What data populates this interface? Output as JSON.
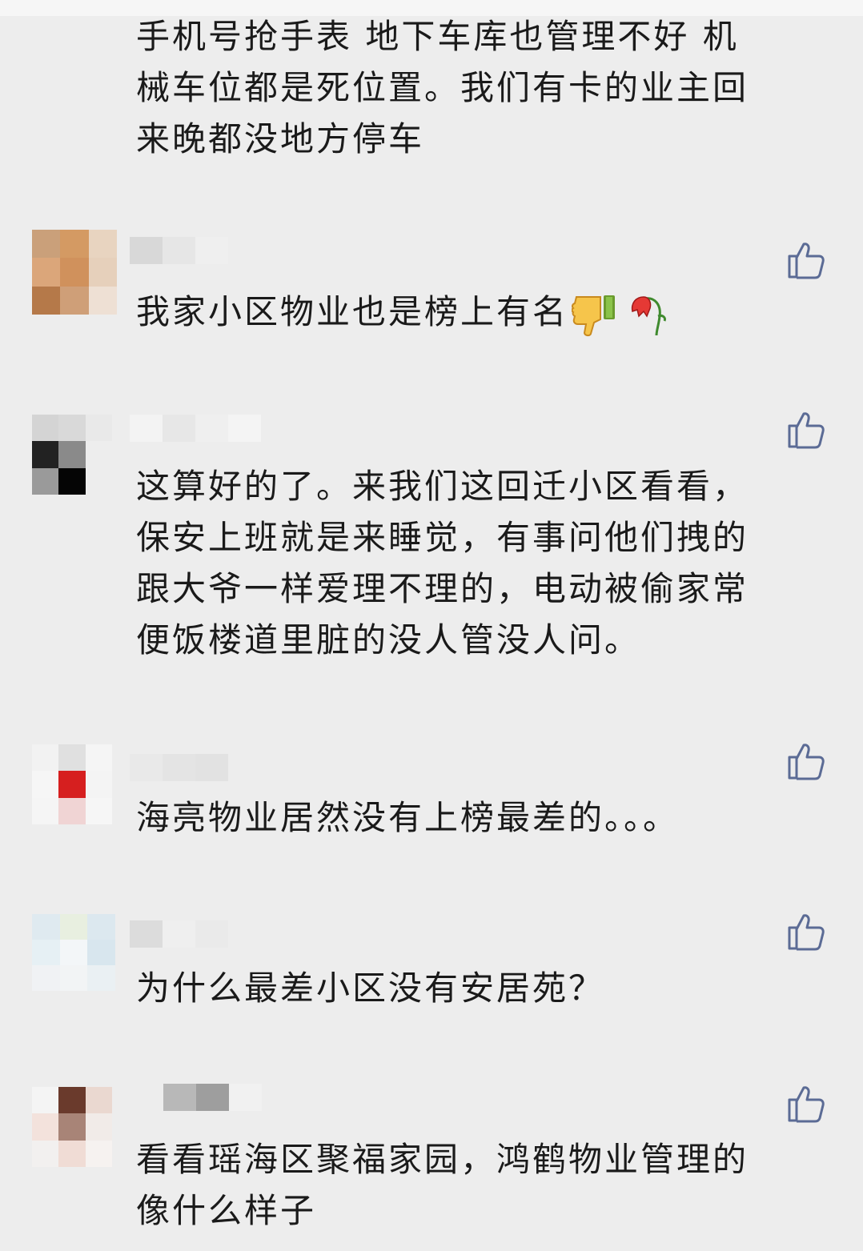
{
  "comments": [
    {
      "text": "手机号抢手表 地下车库也管理不好 机\n械车位都是死位置。我们有卡的业主回\n来晚都没地方停车"
    },
    {
      "text": "我家小区物业也是榜上有名",
      "emojis": [
        "thumbs-down-emoji",
        "wilted-flower-emoji"
      ]
    },
    {
      "text": "这算好的了。来我们这回迁小区看看，\n保安上班就是来睡觉，有事问他们拽的\n跟大爷一样爱理不理的，电动被偷家常\n便饭楼道里脏的没人管没人问。"
    },
    {
      "text": "海亮物业居然没有上榜最差的。。。"
    },
    {
      "text": "为什么最差小区没有安居苑？"
    },
    {
      "text": "看看瑶海区聚福家园，鸿鹤物业管理的\n像什么样子"
    }
  ],
  "icons": {
    "like": "thumbs-up-outline-icon"
  },
  "colors": {
    "background": "#ededed",
    "like_icon": "#5b6b95",
    "text": "#1a1a1a"
  }
}
